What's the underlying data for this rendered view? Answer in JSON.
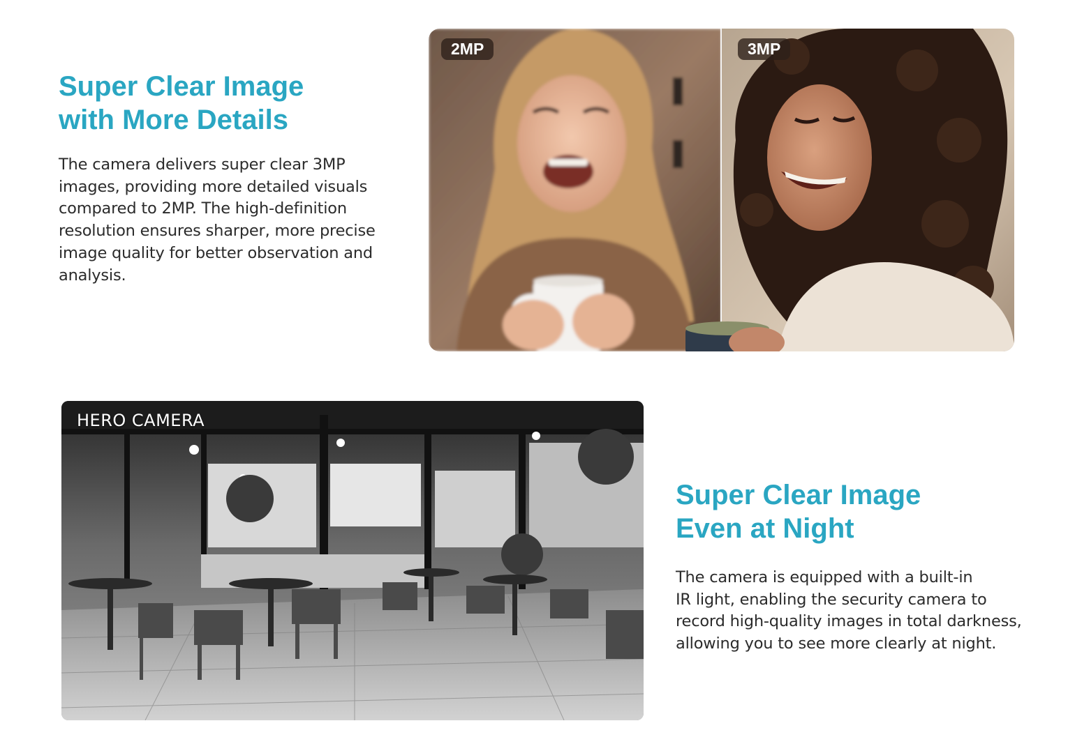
{
  "section_day": {
    "heading_line1": "Super Clear Image",
    "heading_line2": "with More Details",
    "body_lines": [
      "The camera delivers super clear 3MP",
      "images, providing more detailed visuals",
      "compared to 2MP. The high-definition",
      "resolution ensures sharper, more precise",
      "image quality for better observation and",
      "analysis."
    ],
    "badge_left": "2MP",
    "badge_right": "3MP"
  },
  "section_night": {
    "heading_line1": "Super Clear Image",
    "heading_line2": "Even at Night",
    "body_lines": [
      "The camera is equipped with a built-in",
      "IR light, enabling the security camera to",
      "record high-quality images in total darkness,",
      "allowing you to see more clearly at night."
    ],
    "camera_label": "HERO CAMERA"
  },
  "colors": {
    "heading": "#2aa6c2",
    "body_text": "#2b2b2b",
    "badge_bg": "#2d201a"
  }
}
